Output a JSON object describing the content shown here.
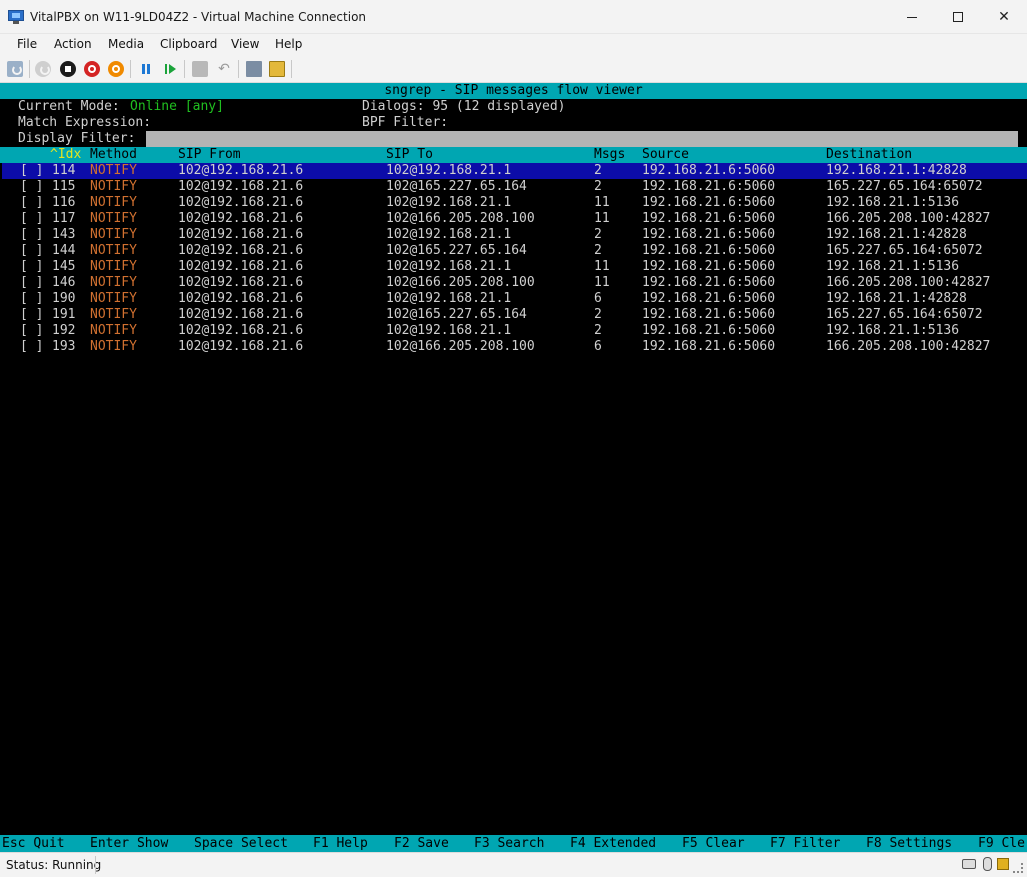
{
  "window": {
    "title": "VitalPBX on W11-9LD04Z2 - Virtual Machine Connection"
  },
  "menu": {
    "items": [
      "File",
      "Action",
      "Media",
      "Clipboard",
      "View",
      "Help"
    ]
  },
  "toolbar": {
    "icons": [
      "ctrl-alt-del-icon",
      "start-icon",
      "turn-off-icon",
      "shut-down-icon",
      "power-icon",
      "pause-icon",
      "resume-icon",
      "checkpoint-icon",
      "revert-icon",
      "share-icon",
      "enhanced-session-icon"
    ]
  },
  "terminal": {
    "title": "sngrep - SIP messages flow viewer",
    "mode_label": "Current Mode:",
    "mode_value": "Online [any]",
    "dialogs": "Dialogs: 95 (12 displayed)",
    "match_label": "Match Expression:",
    "bpf_label": "BPF Filter:",
    "display_filter_label": "Display Filter:",
    "columns": {
      "idx": "^Idx",
      "method": "Method",
      "sip_from": "SIP From",
      "sip_to": "SIP To",
      "msgs": "Msgs",
      "source": "Source",
      "destination": "Destination"
    },
    "rows": [
      {
        "check": "[ ]",
        "idx": "114",
        "method": "NOTIFY",
        "from": "102@192.168.21.6",
        "to": "102@192.168.21.1",
        "msgs": "2",
        "source": "192.168.21.6:5060",
        "destination": "192.168.21.1:42828"
      },
      {
        "check": "[ ]",
        "idx": "115",
        "method": "NOTIFY",
        "from": "102@192.168.21.6",
        "to": "102@165.227.65.164",
        "msgs": "2",
        "source": "192.168.21.6:5060",
        "destination": "165.227.65.164:65072"
      },
      {
        "check": "[ ]",
        "idx": "116",
        "method": "NOTIFY",
        "from": "102@192.168.21.6",
        "to": "102@192.168.21.1",
        "msgs": "11",
        "source": "192.168.21.6:5060",
        "destination": "192.168.21.1:5136"
      },
      {
        "check": "[ ]",
        "idx": "117",
        "method": "NOTIFY",
        "from": "102@192.168.21.6",
        "to": "102@166.205.208.100",
        "msgs": "11",
        "source": "192.168.21.6:5060",
        "destination": "166.205.208.100:42827"
      },
      {
        "check": "[ ]",
        "idx": "143",
        "method": "NOTIFY",
        "from": "102@192.168.21.6",
        "to": "102@192.168.21.1",
        "msgs": "2",
        "source": "192.168.21.6:5060",
        "destination": "192.168.21.1:42828"
      },
      {
        "check": "[ ]",
        "idx": "144",
        "method": "NOTIFY",
        "from": "102@192.168.21.6",
        "to": "102@165.227.65.164",
        "msgs": "2",
        "source": "192.168.21.6:5060",
        "destination": "165.227.65.164:65072"
      },
      {
        "check": "[ ]",
        "idx": "145",
        "method": "NOTIFY",
        "from": "102@192.168.21.6",
        "to": "102@192.168.21.1",
        "msgs": "11",
        "source": "192.168.21.6:5060",
        "destination": "192.168.21.1:5136"
      },
      {
        "check": "[ ]",
        "idx": "146",
        "method": "NOTIFY",
        "from": "102@192.168.21.6",
        "to": "102@166.205.208.100",
        "msgs": "11",
        "source": "192.168.21.6:5060",
        "destination": "166.205.208.100:42827"
      },
      {
        "check": "[ ]",
        "idx": "190",
        "method": "NOTIFY",
        "from": "102@192.168.21.6",
        "to": "102@192.168.21.1",
        "msgs": "6",
        "source": "192.168.21.6:5060",
        "destination": "192.168.21.1:42828"
      },
      {
        "check": "[ ]",
        "idx": "191",
        "method": "NOTIFY",
        "from": "102@192.168.21.6",
        "to": "102@165.227.65.164",
        "msgs": "2",
        "source": "192.168.21.6:5060",
        "destination": "165.227.65.164:65072"
      },
      {
        "check": "[ ]",
        "idx": "192",
        "method": "NOTIFY",
        "from": "102@192.168.21.6",
        "to": "102@192.168.21.1",
        "msgs": "2",
        "source": "192.168.21.6:5060",
        "destination": "192.168.21.1:5136"
      },
      {
        "check": "[ ]",
        "idx": "193",
        "method": "NOTIFY",
        "from": "102@192.168.21.6",
        "to": "102@166.205.208.100",
        "msgs": "6",
        "source": "192.168.21.6:5060",
        "destination": "166.205.208.100:42827"
      }
    ],
    "selected_row": 0,
    "footer_keys": [
      {
        "key": "Esc",
        "action": "Quit"
      },
      {
        "key": "Enter",
        "action": "Show"
      },
      {
        "key": "Space",
        "action": "Select"
      },
      {
        "key": "F1",
        "action": "Help"
      },
      {
        "key": "F2",
        "action": "Save"
      },
      {
        "key": "F3",
        "action": "Search"
      },
      {
        "key": "F4",
        "action": "Extended"
      },
      {
        "key": "F5",
        "action": "Clear"
      },
      {
        "key": "F7",
        "action": "Filter"
      },
      {
        "key": "F8",
        "action": "Settings"
      },
      {
        "key": "F9",
        "action": "Cle"
      }
    ]
  },
  "status": {
    "text": "Status: Running"
  },
  "colors": {
    "terminal_bg": "#000000",
    "header_bar": "#00a6b2",
    "selected_row": "#0c0ca8",
    "method_text": "#d07030",
    "online_text": "#20c020"
  }
}
